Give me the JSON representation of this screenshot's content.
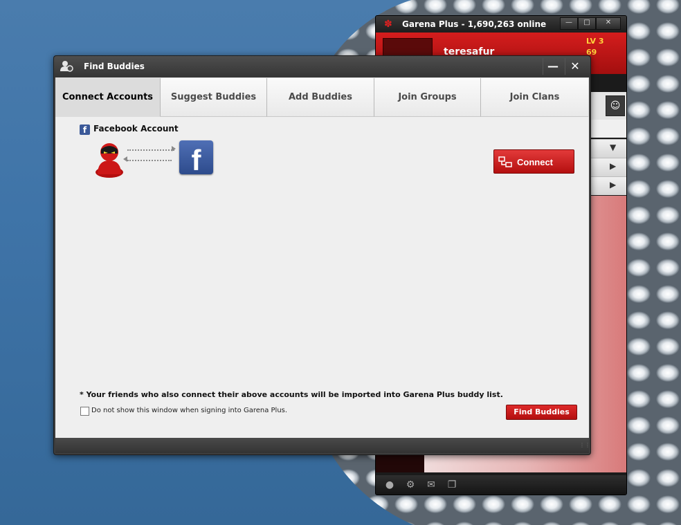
{
  "garena_window": {
    "title": "Garena Plus - 1,690,263 online",
    "username": "teresafur",
    "level": "LV 3",
    "points": "69"
  },
  "dialog": {
    "title": "Find Buddies",
    "tabs": [
      {
        "label": "Connect Accounts",
        "active": true
      },
      {
        "label": "Suggest Buddies",
        "active": false
      },
      {
        "label": "Add Buddies",
        "active": false
      },
      {
        "label": "Join Groups",
        "active": false
      },
      {
        "label": "Join Clans",
        "active": false
      }
    ],
    "facebook_section_label": "Facebook Account",
    "connect_button_label": "Connect",
    "footnote": "* Your friends who also connect their above accounts will be imported into Garena Plus buddy list.",
    "dont_show_label": "Do not show this window when signing into Garena Plus.",
    "find_buddies_button_label": "Find Buddies"
  },
  "colors": {
    "accent_red": "#c91414",
    "facebook_blue": "#3b5998",
    "dialog_dark": "#3d3d3d",
    "content_bg": "#efefef"
  },
  "icons": {
    "dialog_icon": "buddies-icon",
    "facebook_small": "facebook-icon",
    "garena_user": "garena-user-icon",
    "connect": "connect-icon"
  }
}
